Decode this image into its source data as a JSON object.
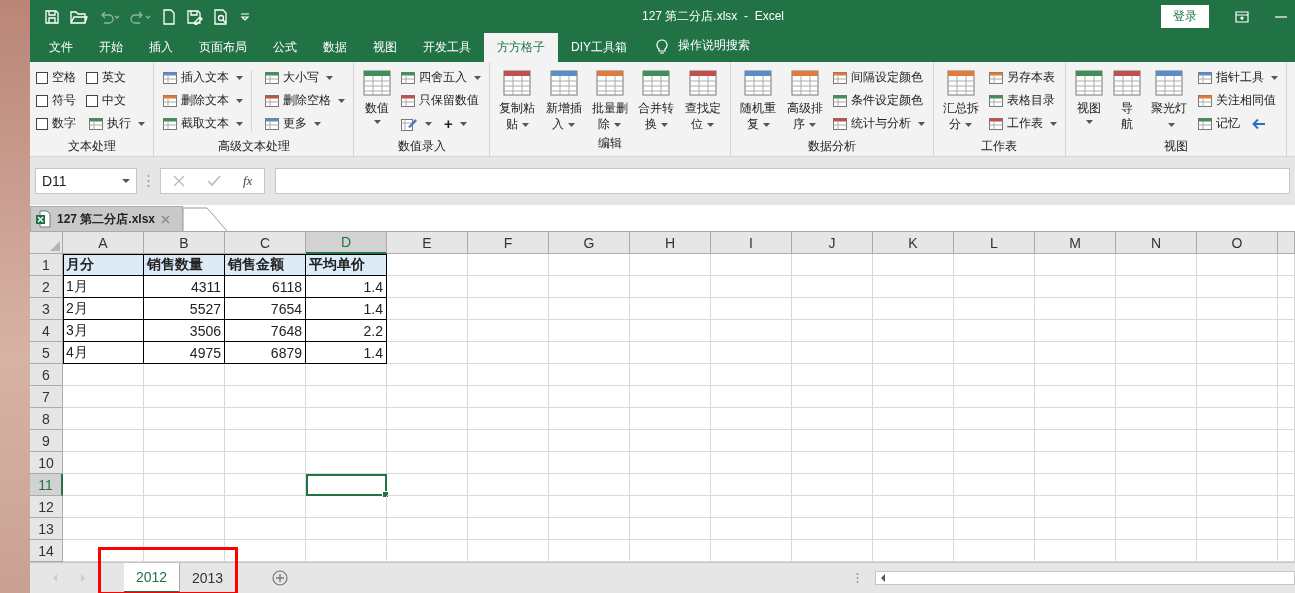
{
  "title_bar": {
    "title": "127 第二分店.xlsx  -  Excel",
    "login": "登录"
  },
  "menu_tabs": [
    {
      "label": "文件",
      "selected": false
    },
    {
      "label": "开始",
      "selected": false
    },
    {
      "label": "插入",
      "selected": false
    },
    {
      "label": "页面布局",
      "selected": false
    },
    {
      "label": "公式",
      "selected": false
    },
    {
      "label": "数据",
      "selected": false
    },
    {
      "label": "视图",
      "selected": false
    },
    {
      "label": "开发工具",
      "selected": false
    },
    {
      "label": "方方格子",
      "selected": true
    },
    {
      "label": "DIY工具箱",
      "selected": false
    }
  ],
  "tell_me": "操作说明搜索",
  "ribbon_groups": [
    {
      "title": "文本处理",
      "columns": [
        {
          "kind": "stack",
          "rows": [
            [
              {
                "kind": "checkbox",
                "label": "空格",
                "checked": false
              }
            ],
            [
              {
                "kind": "checkbox",
                "label": "符号",
                "checked": false
              }
            ],
            [
              {
                "kind": "checkbox",
                "label": "数字",
                "checked": false
              }
            ]
          ]
        },
        {
          "kind": "stack",
          "rows": [
            [
              {
                "kind": "checkbox",
                "label": "英文",
                "checked": false
              }
            ],
            [
              {
                "kind": "checkbox",
                "label": "中文",
                "checked": false
              }
            ],
            [
              {
                "kind": "small",
                "label": "执行",
                "dropdown": true
              }
            ]
          ]
        }
      ]
    },
    {
      "title": "高级文本处理",
      "columns": [
        {
          "kind": "stack",
          "rows": [
            [
              {
                "kind": "small",
                "label": "插入文本",
                "dropdown": true
              }
            ],
            [
              {
                "kind": "small",
                "label": "删除文本",
                "dropdown": true
              }
            ],
            [
              {
                "kind": "small",
                "label": "截取文本",
                "dropdown": true
              }
            ]
          ]
        },
        {
          "kind": "separator"
        },
        {
          "kind": "stack",
          "rows": [
            [
              {
                "kind": "small",
                "label": "大小写",
                "dropdown": true
              }
            ],
            [
              {
                "kind": "small",
                "label": "删除空格",
                "dropdown": true
              }
            ],
            [
              {
                "kind": "small",
                "label": "更多",
                "dropdown": true
              }
            ]
          ]
        }
      ]
    },
    {
      "title": "数值录入",
      "columns": [
        {
          "kind": "large",
          "label": "数值",
          "dropdown": true
        },
        {
          "kind": "stack",
          "rows": [
            [
              {
                "kind": "small",
                "label": "四舍五入",
                "dropdown": true
              }
            ],
            [
              {
                "kind": "small",
                "label": "只保留数值",
                "dropdown": false
              }
            ],
            [
              {
                "kind": "icon",
                "dropdown": true
              },
              {
                "kind": "text",
                "label": "+",
                "dropdown": true
              }
            ]
          ]
        }
      ]
    },
    {
      "title": "编辑",
      "columns": [
        {
          "kind": "large",
          "label": "复制粘贴",
          "dropdown": true
        },
        {
          "kind": "large",
          "label": "新增插入",
          "dropdown": true
        },
        {
          "kind": "large",
          "label": "批量删除",
          "dropdown": true
        },
        {
          "kind": "large",
          "label": "合并转换",
          "dropdown": true
        },
        {
          "kind": "large",
          "label": "查找定位",
          "dropdown": true
        }
      ]
    },
    {
      "title": "数据分析",
      "columns": [
        {
          "kind": "large",
          "label": "随机重复",
          "dropdown": true
        },
        {
          "kind": "large",
          "label": "高级排序",
          "dropdown": true
        },
        {
          "kind": "stack",
          "rows": [
            [
              {
                "kind": "small",
                "label": "间隔设定颜色",
                "dropdown": false
              }
            ],
            [
              {
                "kind": "small",
                "label": "条件设定颜色",
                "dropdown": false
              }
            ],
            [
              {
                "kind": "small",
                "label": "统计与分析",
                "dropdown": true
              }
            ]
          ]
        }
      ]
    },
    {
      "title": "工作表",
      "columns": [
        {
          "kind": "large",
          "label": "汇总拆分",
          "dropdown": true
        },
        {
          "kind": "stack",
          "rows": [
            [
              {
                "kind": "small",
                "label": "另存本表",
                "dropdown": false
              }
            ],
            [
              {
                "kind": "small",
                "label": "表格目录",
                "dropdown": false
              }
            ],
            [
              {
                "kind": "small",
                "label": "工作表",
                "dropdown": true
              }
            ]
          ]
        }
      ]
    },
    {
      "title": "视图",
      "columns": [
        {
          "kind": "large",
          "label": "视图",
          "dropdown": true
        },
        {
          "kind": "tall",
          "label": "导航",
          "dropdown": false
        },
        {
          "kind": "large",
          "label": "聚光灯",
          "dropdown": true
        },
        {
          "kind": "stack",
          "rows": [
            [
              {
                "kind": "small",
                "label": "指针工具",
                "dropdown": true
              }
            ],
            [
              {
                "kind": "small",
                "label": "关注相同值",
                "dropdown": false
              }
            ],
            [
              {
                "kind": "small",
                "label": "记忆",
                "dropdown": false
              },
              {
                "kind": "arrow"
              }
            ]
          ]
        }
      ]
    }
  ],
  "name_box": "D11",
  "function_button": "fx",
  "document_tabs": [
    {
      "label": "127 第二分店.xlsx",
      "selected": true
    }
  ],
  "sheet": {
    "columns": [
      {
        "label": "A",
        "selected": false
      },
      {
        "label": "B",
        "selected": false
      },
      {
        "label": "C",
        "selected": false
      },
      {
        "label": "D",
        "selected": true
      },
      {
        "label": "E",
        "selected": false
      },
      {
        "label": "F",
        "selected": false
      },
      {
        "label": "G",
        "selected": false
      },
      {
        "label": "H",
        "selected": false
      },
      {
        "label": "I",
        "selected": false
      },
      {
        "label": "J",
        "selected": false
      },
      {
        "label": "K",
        "selected": false
      },
      {
        "label": "L",
        "selected": false
      },
      {
        "label": "M",
        "selected": false
      },
      {
        "label": "N",
        "selected": false
      },
      {
        "label": "O",
        "selected": false
      }
    ],
    "rows": [
      {
        "label": "1",
        "selected": false,
        "cells": [
          {
            "text": "月分",
            "kind": "header"
          },
          {
            "text": "销售数量",
            "kind": "header"
          },
          {
            "text": "销售金额",
            "kind": "header"
          },
          {
            "text": "平均单价",
            "kind": "header"
          }
        ]
      },
      {
        "label": "2",
        "selected": false,
        "cells": [
          {
            "text": "1月",
            "kind": "text"
          },
          {
            "text": "4311",
            "kind": "number"
          },
          {
            "text": "6118",
            "kind": "number"
          },
          {
            "text": "1.4",
            "kind": "number"
          }
        ]
      },
      {
        "label": "3",
        "selected": false,
        "cells": [
          {
            "text": "2月",
            "kind": "text"
          },
          {
            "text": "5527",
            "kind": "number"
          },
          {
            "text": "7654",
            "kind": "number"
          },
          {
            "text": "1.4",
            "kind": "number"
          }
        ]
      },
      {
        "label": "4",
        "selected": false,
        "cells": [
          {
            "text": "3月",
            "kind": "text"
          },
          {
            "text": "3506",
            "kind": "number"
          },
          {
            "text": "7648",
            "kind": "number"
          },
          {
            "text": "2.2",
            "kind": "number"
          }
        ]
      },
      {
        "label": "5",
        "selected": false,
        "cells": [
          {
            "text": "4月",
            "kind": "text"
          },
          {
            "text": "4975",
            "kind": "number"
          },
          {
            "text": "6879",
            "kind": "number"
          },
          {
            "text": "1.4",
            "kind": "number"
          }
        ]
      },
      {
        "label": "6",
        "selected": false,
        "cells": []
      },
      {
        "label": "7",
        "selected": false,
        "cells": []
      },
      {
        "label": "8",
        "selected": false,
        "cells": []
      },
      {
        "label": "9",
        "selected": false,
        "cells": []
      },
      {
        "label": "10",
        "selected": false,
        "cells": []
      },
      {
        "label": "11",
        "selected": true,
        "cells": []
      },
      {
        "label": "12",
        "selected": false,
        "cells": []
      },
      {
        "label": "13",
        "selected": false,
        "cells": []
      },
      {
        "label": "14",
        "selected": false,
        "cells": []
      }
    ]
  },
  "sheet_tabs": [
    {
      "label": "2012",
      "selected": true
    },
    {
      "label": "2013",
      "selected": false
    }
  ],
  "sheet_tabs_highlighted": true
}
